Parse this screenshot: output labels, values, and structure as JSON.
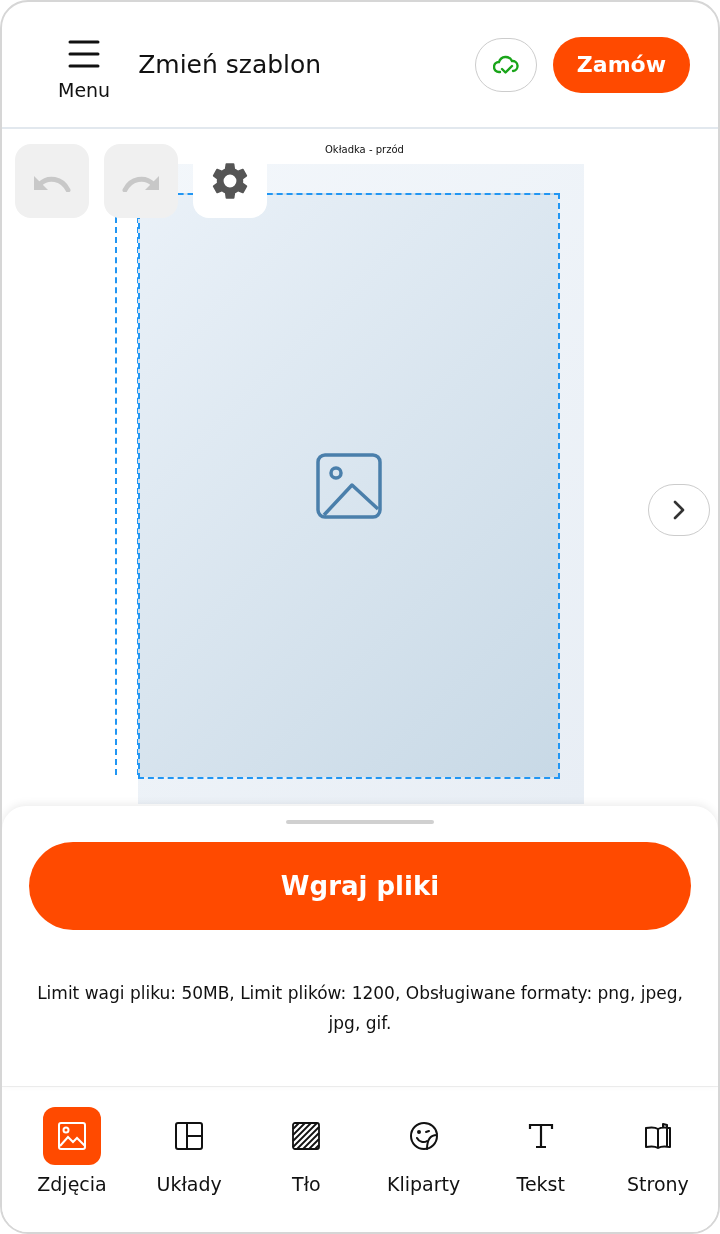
{
  "header": {
    "menu_label": "Menu",
    "title": "Zmień szablon",
    "order_button": "Zamów"
  },
  "canvas": {
    "page_label": "Okładka - przód",
    "undo": {
      "disabled": true
    },
    "redo": {
      "disabled": true
    }
  },
  "sheet": {
    "upload_button": "Wgraj pliki",
    "info": "Limit wagi pliku: 50MB, Limit plików: 1200, Obsługiwane formaty: png, jpeg, jpg, gif."
  },
  "tabs": [
    {
      "kind": "photos",
      "label": "Zdjęcia",
      "selected": true
    },
    {
      "kind": "layouts",
      "label": "Układy",
      "selected": false
    },
    {
      "kind": "background",
      "label": "Tło",
      "selected": false
    },
    {
      "kind": "cliparts",
      "label": "Kliparty",
      "selected": false
    },
    {
      "kind": "text",
      "label": "Tekst",
      "selected": false
    },
    {
      "kind": "pages",
      "label": "Strony",
      "selected": false
    }
  ]
}
